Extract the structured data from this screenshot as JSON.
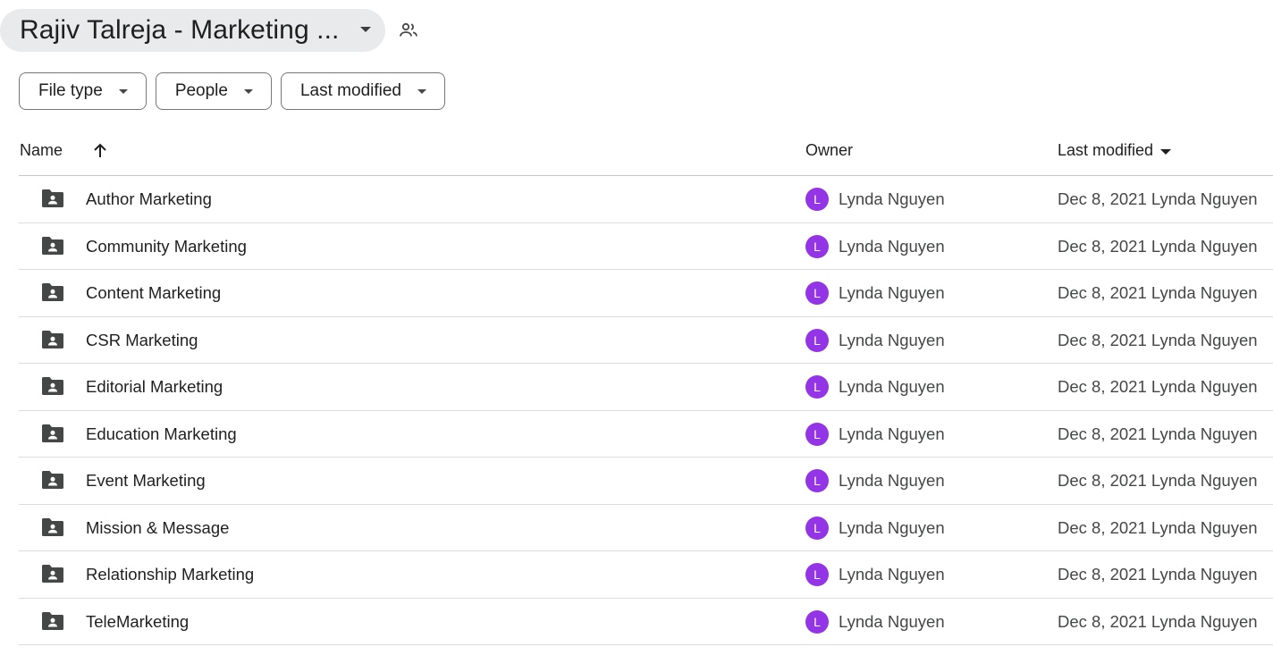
{
  "folder": {
    "title": "Rajiv Talreja - Marketing ...",
    "shared_icon": "people-icon"
  },
  "filters": [
    {
      "label": "File type"
    },
    {
      "label": "People"
    },
    {
      "label": "Last modified"
    }
  ],
  "columns": {
    "name": "Name",
    "owner": "Owner",
    "last_modified": "Last modified",
    "sort_icon": "arrow-up-icon"
  },
  "colors": {
    "avatar_bg": "#9334e6",
    "folder_icon": "#444746",
    "title_pill_bg": "#e9eaec"
  },
  "rows": [
    {
      "name": "Author Marketing",
      "avatar": "L",
      "owner": "Lynda Nguyen",
      "modified": "Dec 8, 2021 Lynda Nguyen"
    },
    {
      "name": "Community Marketing",
      "avatar": "L",
      "owner": "Lynda Nguyen",
      "modified": "Dec 8, 2021 Lynda Nguyen"
    },
    {
      "name": "Content Marketing",
      "avatar": "L",
      "owner": "Lynda Nguyen",
      "modified": "Dec 8, 2021 Lynda Nguyen"
    },
    {
      "name": "CSR Marketing",
      "avatar": "L",
      "owner": "Lynda Nguyen",
      "modified": "Dec 8, 2021 Lynda Nguyen"
    },
    {
      "name": "Editorial Marketing",
      "avatar": "L",
      "owner": "Lynda Nguyen",
      "modified": "Dec 8, 2021 Lynda Nguyen"
    },
    {
      "name": "Education Marketing",
      "avatar": "L",
      "owner": "Lynda Nguyen",
      "modified": "Dec 8, 2021 Lynda Nguyen"
    },
    {
      "name": "Event Marketing",
      "avatar": "L",
      "owner": "Lynda Nguyen",
      "modified": "Dec 8, 2021 Lynda Nguyen"
    },
    {
      "name": "Mission & Message",
      "avatar": "L",
      "owner": "Lynda Nguyen",
      "modified": "Dec 8, 2021 Lynda Nguyen"
    },
    {
      "name": "Relationship Marketing",
      "avatar": "L",
      "owner": "Lynda Nguyen",
      "modified": "Dec 8, 2021 Lynda Nguyen"
    },
    {
      "name": "TeleMarketing",
      "avatar": "L",
      "owner": "Lynda Nguyen",
      "modified": "Dec 8, 2021 Lynda Nguyen"
    }
  ]
}
